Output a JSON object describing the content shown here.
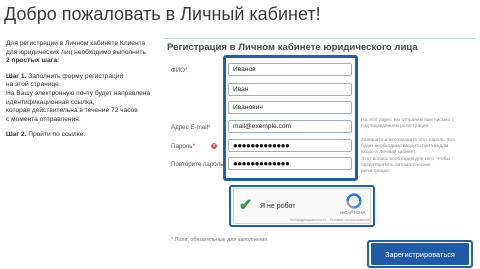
{
  "page": {
    "title": "Добро пожаловать в Личный кабинет!"
  },
  "instructions": {
    "intro_line1": "Для регистрации в Личном кабинете Клиента",
    "intro_line2": "для юридических лиц необходимо выполнить",
    "intro_bold": "2 простых шага:",
    "step1_label": "Шаг 1.",
    "step1_line1": "Заполнить форму регистрации",
    "step1_line2": "на этой странице.",
    "step1_line3": "На Вашу электронную почту будет направлена",
    "step1_line4": "идентификационная ссылка,",
    "step1_line5": "которая действительна в течение 72 часов",
    "step1_line6": "с момента отправления.",
    "step2_label": "Шаг 2.",
    "step2_text": "Пройти по ссылке."
  },
  "form": {
    "title": "Регистрация в Личном кабинете юридического лица",
    "fio_label": "ФИО",
    "required_mark": "*",
    "last_name": "Иванов",
    "first_name": "Иван",
    "patronymic": "Иванович",
    "email_label": "Адрес E-mail",
    "email_value": "mail@exemple.com",
    "password_label": "Пароль",
    "password_value": "●●●●●●●●●●●●●",
    "password_repeat_label": "Повторите пароль",
    "password_repeat_value": "●●●●●●●●●●●●●",
    "help_icon_glyph": "?",
    "hint_email_line1": "На этот адрес мы отправим вам письмо с",
    "hint_email_line2": "подтверждением регистрации.",
    "hint_password_line1": "Запишите или сохраните этот пароль. Его",
    "hint_password_line2": "будет необходимо вводить при каждом",
    "hint_password_line3": "входе в Личный кабинет.",
    "hint_repeat_line1": "Этот вопрос необходим для того, чтобы",
    "hint_repeat_line2": "предотвратить автоматические",
    "hint_repeat_line3": "регистрации.",
    "captcha_check": "✔",
    "captcha_label": "Я не робот",
    "captcha_brand": "reCAPTCHA",
    "captcha_links": "Конфиденциальность - Условия использования",
    "required_note": "* Поля, обязательные для заполнения",
    "submit_label": "Зарегистрироваться"
  },
  "colors": {
    "accent": "#1e5fae",
    "button": "#1e5aa8",
    "check": "#2e9c3f",
    "required": "#c0392b"
  }
}
